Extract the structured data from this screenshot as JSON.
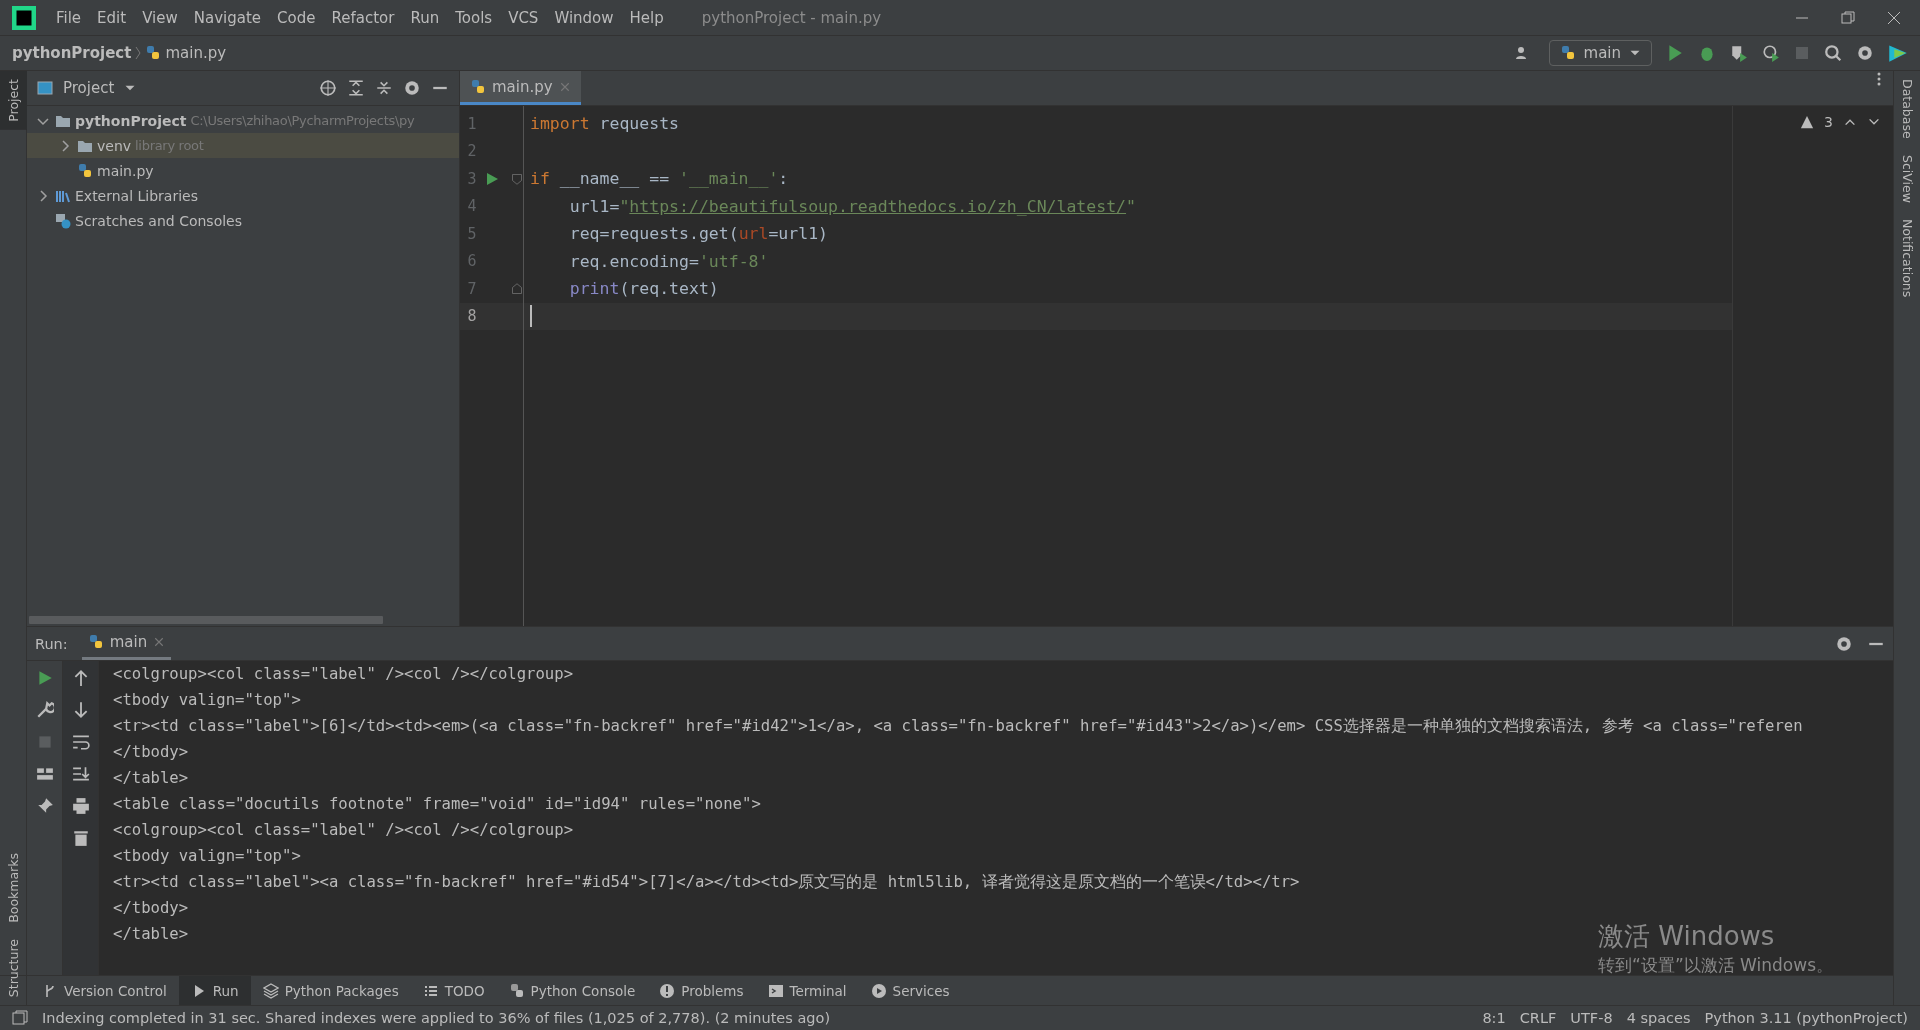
{
  "menu": [
    "File",
    "Edit",
    "View",
    "Navigate",
    "Code",
    "Refactor",
    "Run",
    "Tools",
    "VCS",
    "Window",
    "Help"
  ],
  "window": {
    "title": "pythonProject - main.py"
  },
  "breadcrumb": [
    "pythonProject",
    "main.py"
  ],
  "run_config": "main",
  "left_strip": [
    {
      "label": "Project",
      "selected": true
    },
    {
      "label": "Bookmarks",
      "selected": false
    },
    {
      "label": "Structure",
      "selected": false
    }
  ],
  "right_strip": [
    "Database",
    "SciView",
    "Notifications"
  ],
  "project_panel": {
    "title": "Project",
    "tree": [
      {
        "kind": "folder",
        "name": "pythonProject",
        "bold": true,
        "hint": "C:\\Users\\zhihao\\PycharmProjects\\py",
        "expanded": true,
        "selected": false,
        "children": [
          {
            "kind": "folder",
            "name": "venv",
            "hint": "library root",
            "expanded": false,
            "selected": true
          },
          {
            "kind": "python",
            "name": "main.py",
            "selected": false
          }
        ]
      },
      {
        "kind": "library",
        "name": "External Libraries",
        "expanded": false,
        "selected": false
      },
      {
        "kind": "scratches",
        "name": "Scratches and Consoles",
        "selected": false
      }
    ]
  },
  "editor": {
    "tabs": [
      {
        "label": "main.py",
        "selected": true
      }
    ],
    "warnings": "3",
    "lines": [
      {
        "number": "1",
        "current": false,
        "tokens": [
          {
            "kind": "keyword",
            "t": "import"
          },
          {
            "kind": "plain",
            "t": " requests"
          }
        ]
      },
      {
        "number": "2",
        "current": false
      },
      {
        "number": "3",
        "current": false,
        "run_marker": true,
        "fold_start": true,
        "tokens": [
          {
            "kind": "keyword",
            "t": "if"
          },
          {
            "kind": "plain",
            "t": " __name__ == "
          },
          {
            "kind": "string",
            "t": "'__main__'"
          },
          {
            "kind": "plain",
            "t": ":"
          }
        ]
      },
      {
        "number": "4",
        "current": false,
        "tokens": [
          {
            "kind": "plain",
            "t": "    url1="
          },
          {
            "kind": "string",
            "t": "\""
          },
          {
            "kind": "link",
            "t": "https://beautifulsoup.readthedocs.io/zh_CN/latest/"
          },
          {
            "kind": "string",
            "t": "\""
          }
        ]
      },
      {
        "number": "5",
        "current": false,
        "tokens": [
          {
            "kind": "plain",
            "t": "    req=requests.get("
          },
          {
            "kind": "parameter",
            "t": "url"
          },
          {
            "kind": "plain",
            "t": "=url1)"
          }
        ]
      },
      {
        "number": "6",
        "current": false,
        "tokens": [
          {
            "kind": "plain",
            "t": "    req.encoding="
          },
          {
            "kind": "string",
            "t": "'utf-8'"
          }
        ]
      },
      {
        "number": "7",
        "current": false,
        "fold_end": true,
        "tokens": [
          {
            "kind": "builtin",
            "t": "    print"
          },
          {
            "kind": "plain",
            "t": "(req.text)"
          }
        ]
      },
      {
        "number": "8",
        "current": true
      }
    ]
  },
  "run_panel": {
    "label": "Run:",
    "tabs": [
      {
        "label": "main",
        "selected": true
      }
    ],
    "output": [
      "<colgroup><col class=\"label\" /><col /></colgroup>",
      "<tbody valign=\"top\">",
      "<tr><td class=\"label\">[6]</td><td><em>(<a class=\"fn-backref\" href=\"#id42\">1</a>, <a class=\"fn-backref\" href=\"#id43\">2</a>)</em> CSS选择器是一种单独的文档搜索语法, 参考 <a class=\"referen",
      "</tbody>",
      "</table>",
      "<table class=\"docutils footnote\" frame=\"void\" id=\"id94\" rules=\"none\">",
      "<colgroup><col class=\"label\" /><col /></colgroup>",
      "<tbody valign=\"top\">",
      "<tr><td class=\"label\"><a class=\"fn-backref\" href=\"#id54\">[7]</a></td><td>原文写的是 html5lib, 译者觉得这是原文档的一个笔误</td></tr>",
      "</tbody>",
      "</table>"
    ]
  },
  "activation": {
    "title": "激活 Windows",
    "subtitle": "转到“设置”以激活 Windows。"
  },
  "tool_tabs": [
    {
      "kind": "vcs",
      "label": "Version Control",
      "selected": false
    },
    {
      "kind": "run",
      "label": "Run",
      "selected": true
    },
    {
      "kind": "packages",
      "label": "Python Packages",
      "selected": false
    },
    {
      "kind": "todo",
      "label": "TODO",
      "selected": false
    },
    {
      "kind": "console",
      "label": "Python Console",
      "selected": false
    },
    {
      "kind": "problems",
      "label": "Problems",
      "selected": false
    },
    {
      "kind": "terminal",
      "label": "Terminal",
      "selected": false
    },
    {
      "kind": "services",
      "label": "Services",
      "selected": false
    }
  ],
  "status_bar": {
    "message": "Indexing completed in 31 sec. Shared indexes were applied to 36% of files (1,025 of 2,778). (2 minutes ago)",
    "items": [
      "8:1",
      "CRLF",
      "UTF-8",
      "4 spaces",
      "Python 3.11 (pythonProject)"
    ]
  }
}
